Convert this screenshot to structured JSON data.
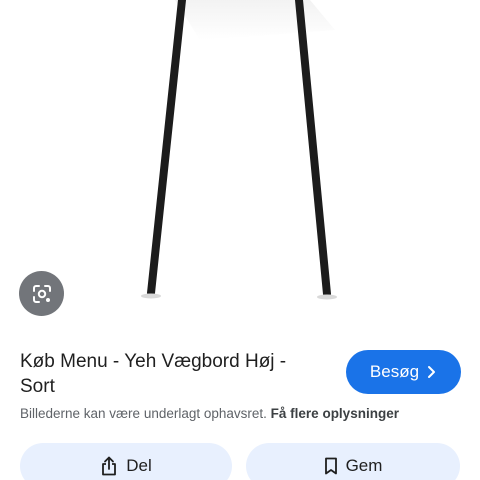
{
  "result": {
    "title": "Køb Menu - Yeh Vægbord Høj - Sort",
    "visit_label": "Besøg",
    "copyright_notice": "Billederne kan være underlagt ophavsret.",
    "more_info_link": "Få flere oplysninger"
  },
  "actions": {
    "share_label": "Del",
    "save_label": "Gem"
  },
  "icons": {
    "lens": "google-lens-icon",
    "visit": "chevron-right-icon",
    "share": "share-icon",
    "save": "bookmark-icon"
  },
  "colors": {
    "accent": "#1a73e8",
    "action_bg": "#e8f0fe",
    "secondary_text": "#5f6368"
  }
}
